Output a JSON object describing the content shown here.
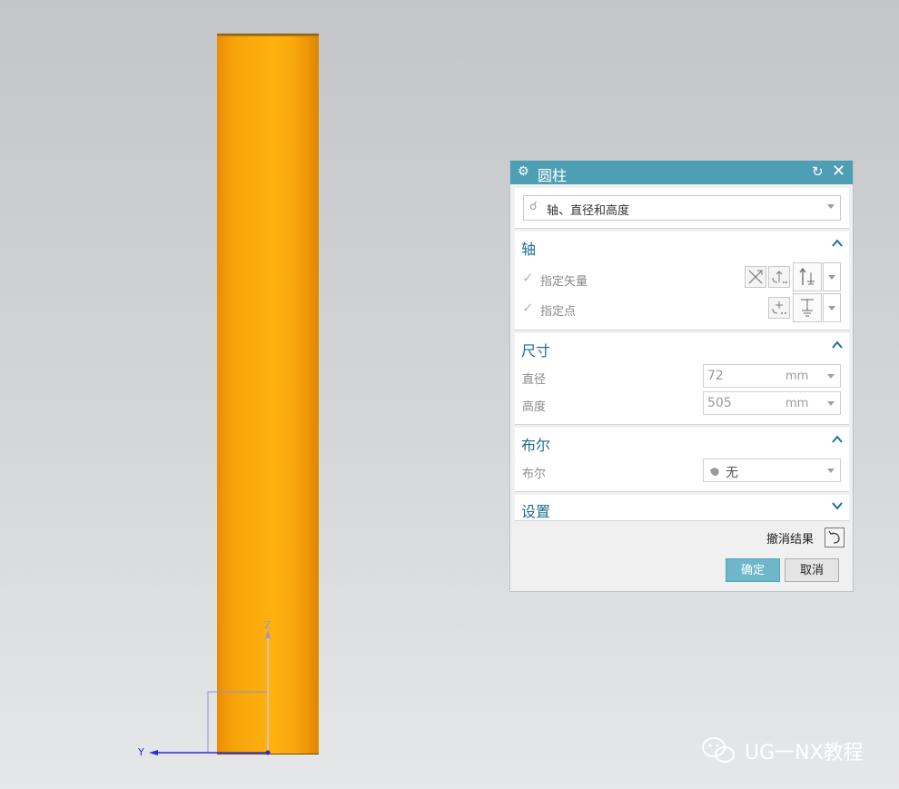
{
  "viewport": {
    "axis_z": "Z",
    "axis_y": "Y"
  },
  "dialog": {
    "title": "圆柱",
    "type_select": "轴、直径和高度",
    "axis_section": {
      "header": "轴",
      "specify_vector": "指定矢量",
      "specify_point": "指定点"
    },
    "dimensions_section": {
      "header": "尺寸",
      "diameter_label": "直径",
      "diameter_value": "72",
      "diameter_unit": "mm",
      "height_label": "高度",
      "height_value": "505",
      "height_unit": "mm"
    },
    "boolean_section": {
      "header": "布尔",
      "label": "布尔",
      "value": "无"
    },
    "settings_section": {
      "header": "设置"
    },
    "undo_result": "撤消结果",
    "ok_button": "确定",
    "cancel_button": "取消"
  },
  "watermark": "UG一NX教程",
  "colors": {
    "titlebar": "#4f9fb4",
    "section_header": "#1f6f8f",
    "cylinder": "#fcae0e",
    "ok_button": "#6eb7c9"
  }
}
